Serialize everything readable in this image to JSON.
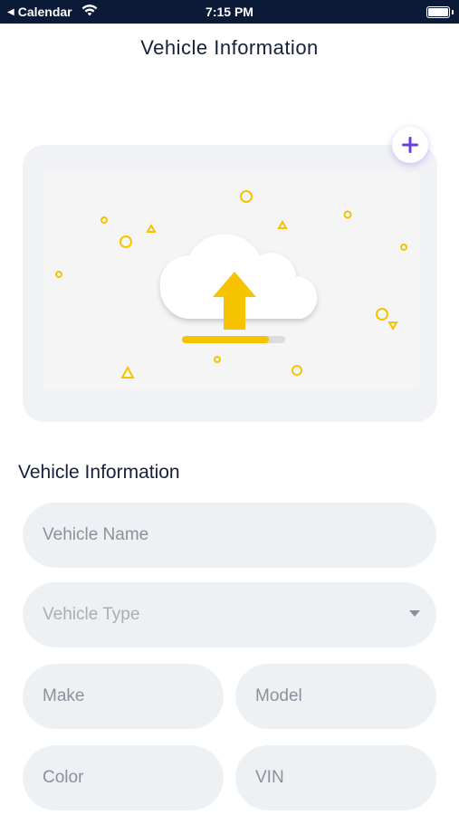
{
  "status_bar": {
    "back_label": "Calendar",
    "time": "7:15 PM"
  },
  "header": {
    "title": "Vehicle Information"
  },
  "upload": {
    "illustration_icon": "cloud-upload-icon",
    "progress_fraction": 0.84,
    "add_icon": "plus-icon",
    "accent_color": "#f7c200",
    "add_color": "#6a3de8"
  },
  "form": {
    "section_title": "Vehicle Information",
    "vehicle_name_placeholder": "Vehicle Name",
    "vehicle_type_placeholder": "Vehicle Type",
    "make_placeholder": "Make",
    "model_placeholder": "Model",
    "color_placeholder": "Color",
    "vin_placeholder": "VIN"
  }
}
